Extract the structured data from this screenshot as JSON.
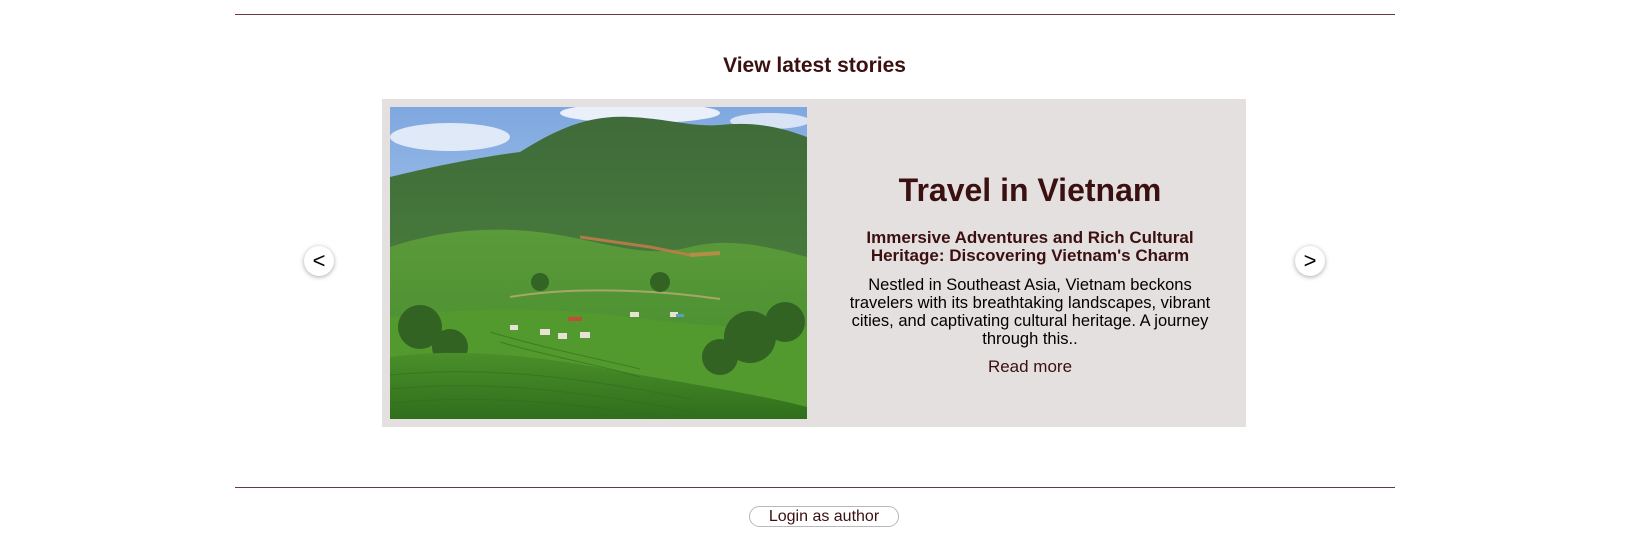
{
  "section": {
    "title": "View latest stories"
  },
  "carousel": {
    "prev_label": "<",
    "next_label": ">",
    "story": {
      "image_alt": "Terraced rice fields and a village in a green mountain valley",
      "title": "Travel in Vietnam",
      "subtitle": "Immersive Adventures and Rich Cultural Heritage: Discovering Vietnam's Charm",
      "excerpt": "Nestled in Southeast Asia, Vietnam beckons travelers with its breathtaking landscapes, vibrant cities, and captivating cultural heritage. A journey through this..",
      "read_more": "Read more"
    }
  },
  "footer": {
    "login_label": "Login as author"
  },
  "colors": {
    "accent": "#3b1010",
    "card_background": "#e4e0df",
    "divider": "#6b3a3e"
  }
}
